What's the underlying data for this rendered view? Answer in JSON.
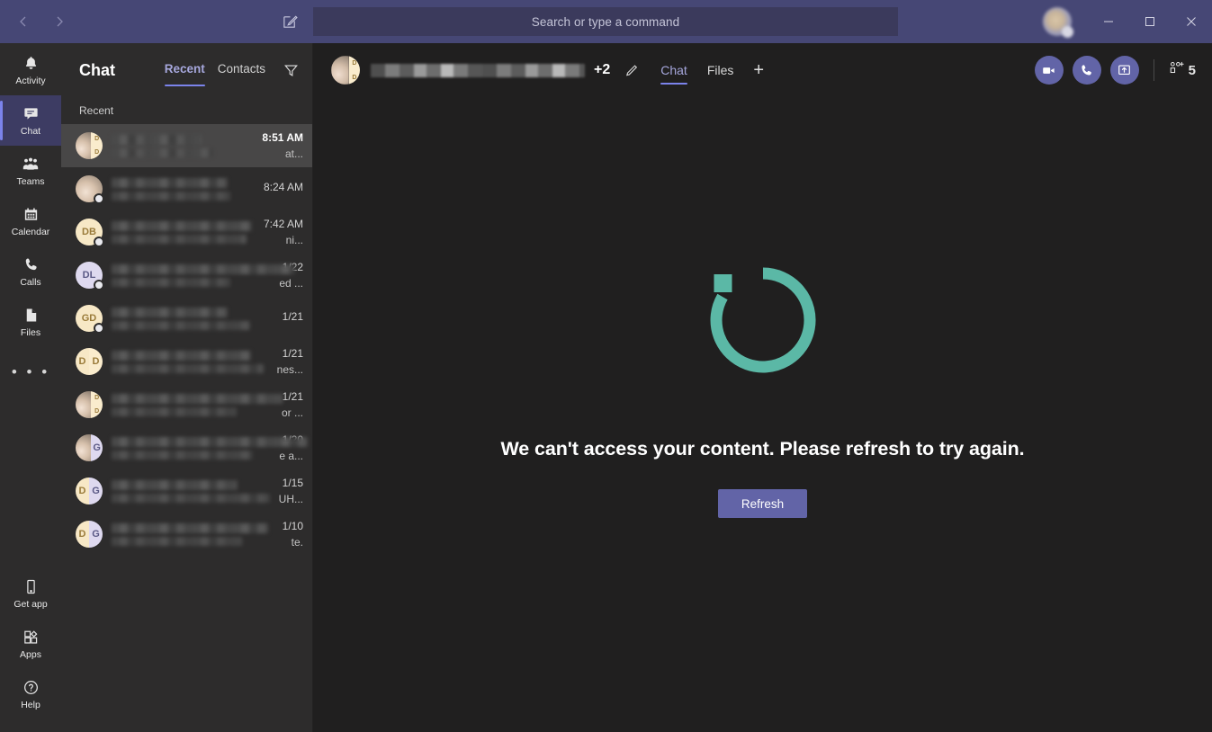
{
  "app": {
    "name": "Microsoft Teams",
    "accent": "#6264a7",
    "titlebar_bg": "#464775",
    "rail_bg": "#2d2c2c",
    "main_bg": "#201f1f",
    "tab_underline": "#7b83eb",
    "refresh_icon_color": "#5bb8a6"
  },
  "titlebar": {
    "back_icon": "chevron-left-icon",
    "forward_icon": "chevron-right-icon",
    "compose_icon": "compose-new-chat-icon",
    "search": {
      "placeholder": "Search or type a command",
      "value": ""
    },
    "avatar_icon": "user-avatar",
    "minimize_label": "–",
    "maximize_label": "□",
    "close_label": "✕"
  },
  "rail": {
    "items": [
      {
        "label": "Activity",
        "icon": "bell-icon",
        "active": false
      },
      {
        "label": "Chat",
        "icon": "chat-bubble-icon",
        "active": true
      },
      {
        "label": "Teams",
        "icon": "teams-people-icon",
        "active": false
      },
      {
        "label": "Calendar",
        "icon": "calendar-icon",
        "active": false
      },
      {
        "label": "Calls",
        "icon": "phone-icon",
        "active": false
      },
      {
        "label": "Files",
        "icon": "file-icon",
        "active": false
      }
    ],
    "more_label": "• • •",
    "bottom_items": [
      {
        "label": "Get app",
        "icon": "mobile-phone-icon"
      },
      {
        "label": "Apps",
        "icon": "apps-grid-icon"
      },
      {
        "label": "Help",
        "icon": "help-circle-icon"
      }
    ]
  },
  "chat_list": {
    "title": "Chat",
    "tabs": [
      {
        "label": "Recent",
        "active": true
      },
      {
        "label": "Contacts",
        "active": false
      }
    ],
    "filter_icon": "filter-funnel-icon",
    "section_label": "Recent",
    "items": [
      {
        "time": "8:51 AM",
        "snippet": "at...",
        "selected": true,
        "avatar": {
          "type": "photo-split",
          "initials": [
            "D",
            "D"
          ],
          "presence": "none"
        }
      },
      {
        "time": "8:24 AM",
        "snippet": "",
        "selected": false,
        "avatar": {
          "type": "photo",
          "initials": [],
          "presence": "offline"
        }
      },
      {
        "time": "7:42 AM",
        "snippet": "ni...",
        "selected": false,
        "avatar": {
          "type": "initials",
          "initials": [
            "DB"
          ],
          "presence": "offline"
        }
      },
      {
        "time": "1/22",
        "snippet": "ed ...",
        "selected": false,
        "avatar": {
          "type": "initials",
          "initials": [
            "DL"
          ],
          "presence": "offline"
        }
      },
      {
        "time": "1/21",
        "snippet": "",
        "selected": false,
        "avatar": {
          "type": "initials",
          "initials": [
            "GD"
          ],
          "presence": "offline"
        }
      },
      {
        "time": "1/21",
        "snippet": "nes...",
        "selected": false,
        "avatar": {
          "type": "split",
          "initials": [
            "D",
            "D"
          ],
          "presence": "none"
        }
      },
      {
        "time": "1/21",
        "snippet": "or ...",
        "selected": false,
        "avatar": {
          "type": "photo-split",
          "initials": [
            "D",
            "D"
          ],
          "presence": "none"
        }
      },
      {
        "time": "1/20",
        "snippet": "e a...",
        "selected": false,
        "avatar": {
          "type": "photo-split",
          "initials": [
            "G"
          ],
          "presence": "none"
        }
      },
      {
        "time": "1/15",
        "snippet": "UH...",
        "selected": false,
        "avatar": {
          "type": "split",
          "initials": [
            "D",
            "G"
          ],
          "presence": "none"
        }
      },
      {
        "time": "1/10",
        "snippet": "te.",
        "selected": false,
        "avatar": {
          "type": "split",
          "initials": [
            "D",
            "G"
          ],
          "presence": "none"
        }
      }
    ]
  },
  "chat_header": {
    "avatar_icon": "group-avatar",
    "title_redacted": true,
    "extra_members": "+2",
    "edit_icon": "pencil-edit-icon",
    "tabs": [
      {
        "label": "Chat",
        "active": true
      },
      {
        "label": "Files",
        "active": false
      }
    ],
    "add_tab_label": "+",
    "actions": [
      {
        "icon": "video-camera-icon",
        "name": "video-call-button"
      },
      {
        "icon": "phone-icon",
        "name": "audio-call-button"
      },
      {
        "icon": "screen-share-icon",
        "name": "screen-share-button"
      }
    ],
    "people": {
      "icon": "add-people-icon",
      "count": "5"
    }
  },
  "content": {
    "error_icon": "refresh-circular-arrow-icon",
    "error_message": "We can't access your content. Please refresh to try again.",
    "refresh_button": "Refresh"
  }
}
